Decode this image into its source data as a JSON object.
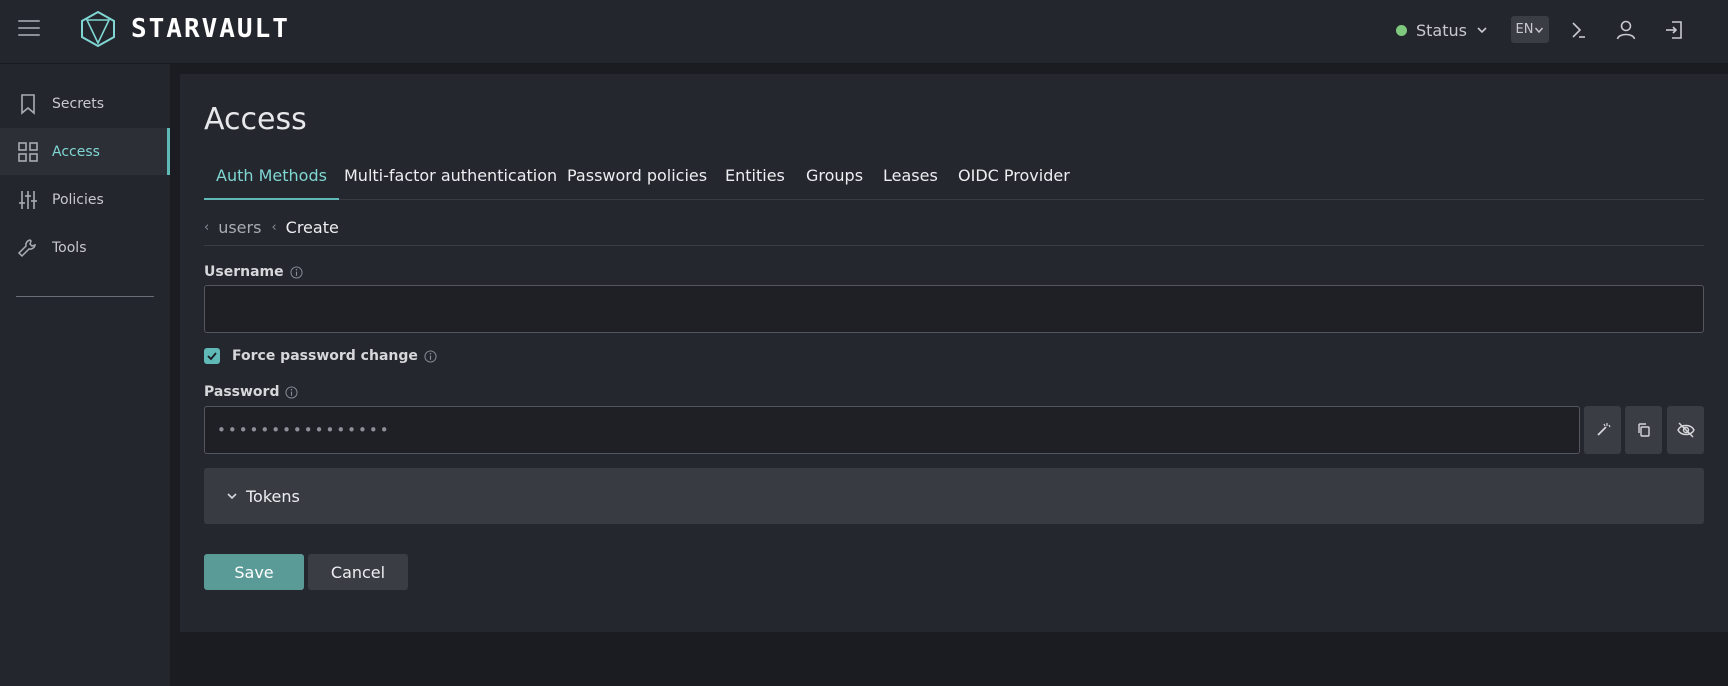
{
  "header": {
    "logo_text": "STARVAULT",
    "status_label": "Status",
    "language": "EN"
  },
  "sidebar": {
    "items": [
      {
        "label": "Secrets",
        "icon": "bookmark-icon"
      },
      {
        "label": "Access",
        "icon": "grid-icon"
      },
      {
        "label": "Policies",
        "icon": "sliders-icon"
      },
      {
        "label": "Tools",
        "icon": "wrench-icon"
      }
    ],
    "active": "Access"
  },
  "main": {
    "title": "Access",
    "tabs": [
      {
        "label": "Auth Methods"
      },
      {
        "label": "Multi-factor authentication"
      },
      {
        "label": "Password policies"
      },
      {
        "label": "Entities"
      },
      {
        "label": "Groups"
      },
      {
        "label": "Leases"
      },
      {
        "label": "OIDC Provider"
      }
    ],
    "breadcrumb": {
      "parent": "users",
      "current": "Create"
    },
    "form": {
      "username_label": "Username",
      "username_value": "",
      "force_password_label": "Force password change",
      "force_password_checked": true,
      "password_label": "Password",
      "password_value": "••••••••••••••••",
      "tokens_label": "Tokens",
      "save_label": "Save",
      "cancel_label": "Cancel"
    }
  },
  "colors": {
    "accent": "#5fbab7",
    "status_ok": "#7fc97f",
    "save_button": "#5a9b98"
  }
}
